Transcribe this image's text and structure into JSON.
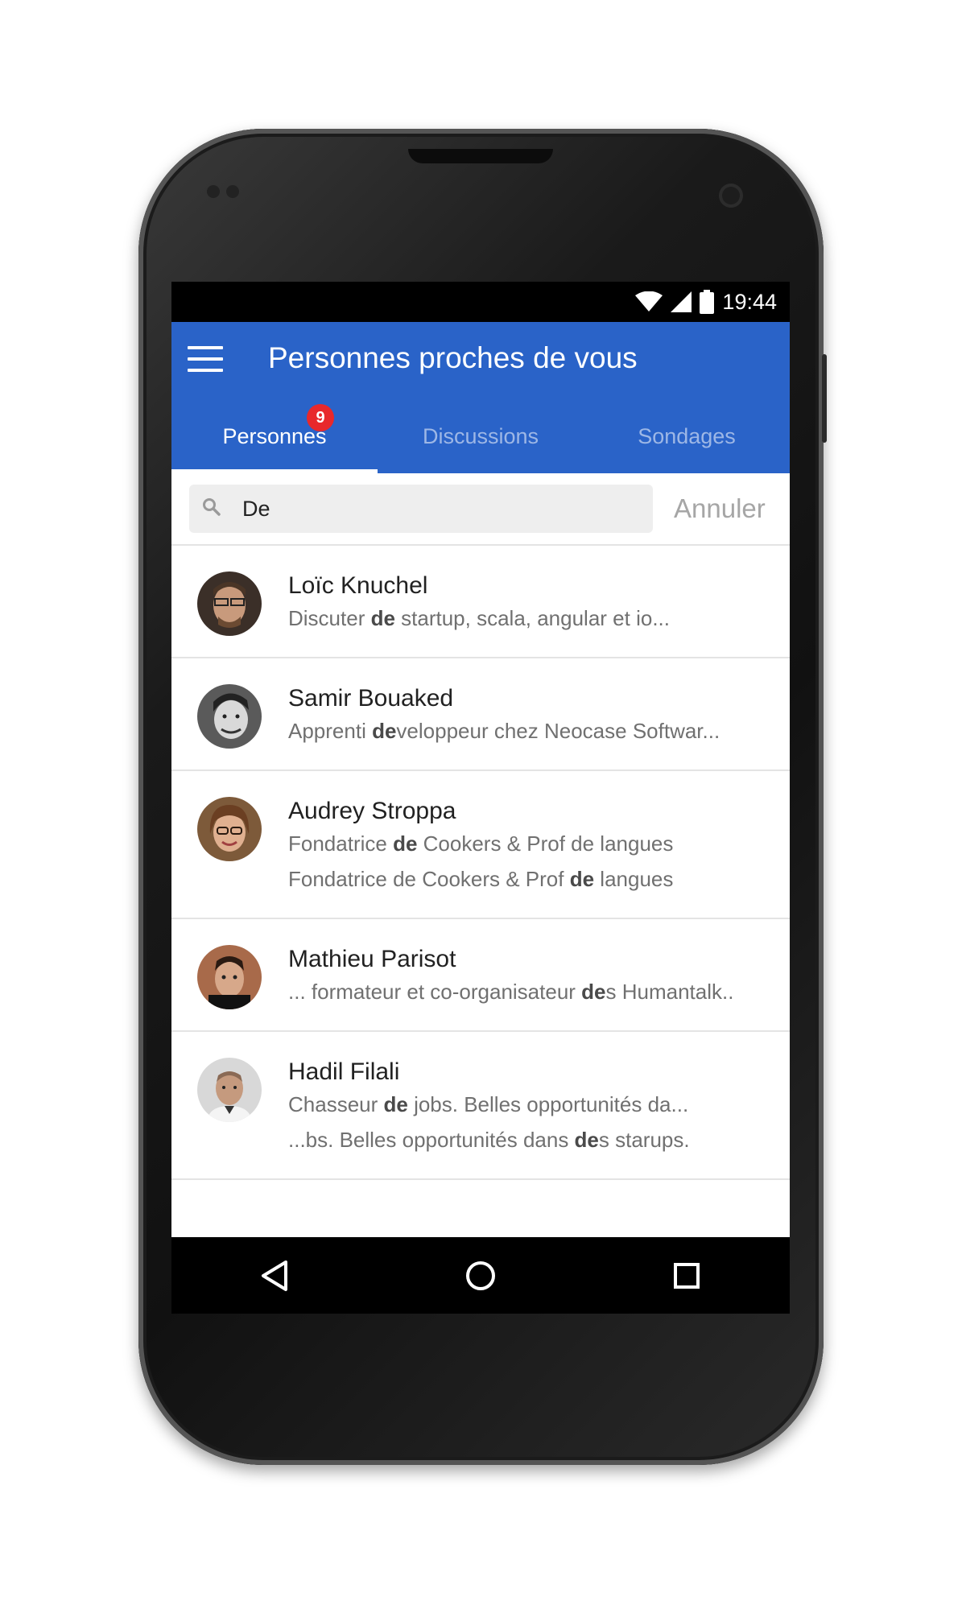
{
  "status_bar": {
    "time": "19:44"
  },
  "app_bar": {
    "title": "Personnes proches de vous"
  },
  "tabs": [
    {
      "label": "Personnes",
      "badge": "9",
      "active": true
    },
    {
      "label": "Discussions",
      "active": false
    },
    {
      "label": "Sondages",
      "active": false
    }
  ],
  "search": {
    "value": "De",
    "cancel_label": "Annuler"
  },
  "people": [
    {
      "name": "Loïc Knuchel",
      "lines": [
        {
          "before": "Discuter ",
          "match": "de",
          "after": " startup, scala, angular et io..."
        }
      ]
    },
    {
      "name": "Samir Bouaked",
      "lines": [
        {
          "before": "Apprenti ",
          "match": "de",
          "after": "veloppeur chez Neocase Softwar..."
        }
      ]
    },
    {
      "name": "Audrey Stroppa",
      "lines": [
        {
          "before": "Fondatrice ",
          "match": "de",
          "after": " Cookers & Prof de langues"
        },
        {
          "before": "Fondatrice de Cookers & Prof ",
          "match": "de",
          "after": " langues"
        }
      ]
    },
    {
      "name": "Mathieu Parisot",
      "lines": [
        {
          "before": "... formateur et co-organisateur ",
          "match": "de",
          "after": "s Humantalk.."
        }
      ]
    },
    {
      "name": "Hadil Filali",
      "lines": [
        {
          "before": "Chasseur ",
          "match": "de",
          "after": " jobs. Belles opportunités da..."
        },
        {
          "before": "...bs. Belles opportunités dans ",
          "match": "de",
          "after": "s starups."
        }
      ]
    }
  ],
  "colors": {
    "app_bar": "#2a63c8",
    "badge": "#e8282b",
    "inactive_tab": "#9db7e6"
  },
  "icons": [
    "menu-icon",
    "search-icon",
    "wifi-icon",
    "signal-icon",
    "battery-icon",
    "back-icon",
    "home-icon",
    "recents-icon"
  ]
}
